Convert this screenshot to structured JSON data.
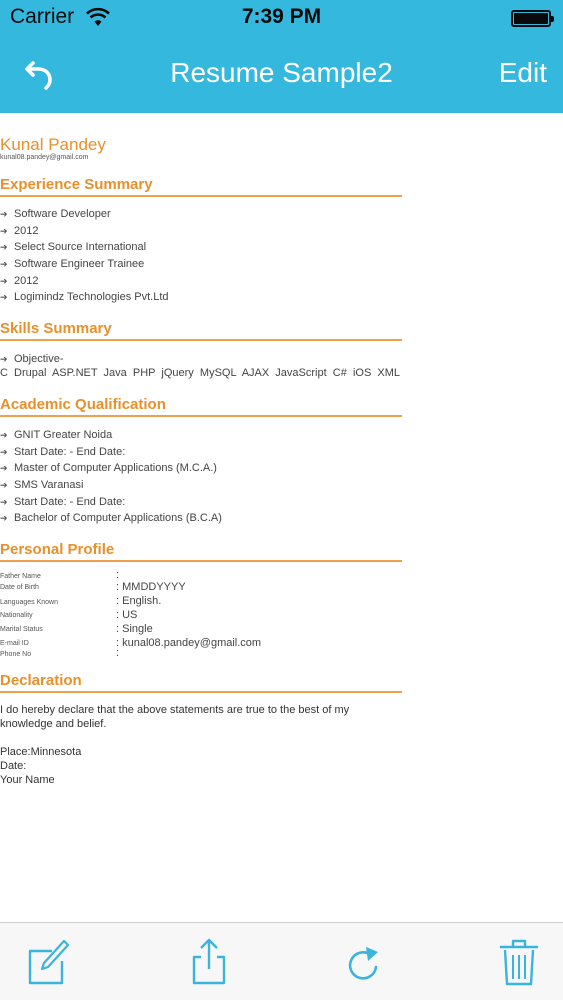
{
  "status_bar": {
    "carrier": "Carrier",
    "time": "7:39 PM"
  },
  "nav": {
    "title": "Resume Sample2",
    "edit_label": "Edit"
  },
  "resume": {
    "name": "Kunal Pandey",
    "email": "kunal08.pandey@gmail.com",
    "experience": {
      "title": "Experience Summary",
      "items": [
        "Software Developer",
        "2012",
        "Select Source International",
        "Software Engineer Trainee",
        "2012",
        "Logimindz Technologies Pvt.Ltd"
      ]
    },
    "skills": {
      "title": "Skills Summary",
      "line1": "Objective-",
      "line2": "C  Drupal  ASP.NET  Java  PHP  jQuery  MySQL  AJAX  JavaScript  C#  iOS  XML"
    },
    "academic": {
      "title": "Academic Qualification",
      "items": [
        "GNIT Greater Noida",
        "Start Date: -  End Date:",
        "Master of Computer Applications (M.C.A.)",
        "SMS Varanasi",
        "Start Date: -  End Date:",
        "Bachelor of Computer Applications (B.C.A)"
      ]
    },
    "personal": {
      "title": "Personal Profile",
      "rows": [
        {
          "label": "Father Name",
          "value": ":"
        },
        {
          "label": "Date of Birth",
          "value": ": MMDDYYYY"
        },
        {
          "label": "Languages Known",
          "value": ": English."
        },
        {
          "label": "Nationality",
          "value": ": US"
        },
        {
          "label": "Marital Status",
          "value": ": Single"
        },
        {
          "label": "E-mail ID",
          "value": ": kunal08.pandey@gmail.com"
        },
        {
          "label": "Phone No",
          "value": ":"
        }
      ]
    },
    "declaration": {
      "title": "Declaration",
      "line1": "I do hereby declare that the above statements are true to the best of my",
      "line2": "knowledge and belief.",
      "place": "Place:Minnesota",
      "date": "Date:",
      "your_name": "Your Name"
    }
  },
  "toolbar": {
    "icons": [
      "compose-icon",
      "share-icon",
      "refresh-icon",
      "trash-icon"
    ],
    "icon_color": "#3ab4dc"
  },
  "colors": {
    "header": "#35b8dd",
    "accent": "#e8902b"
  }
}
